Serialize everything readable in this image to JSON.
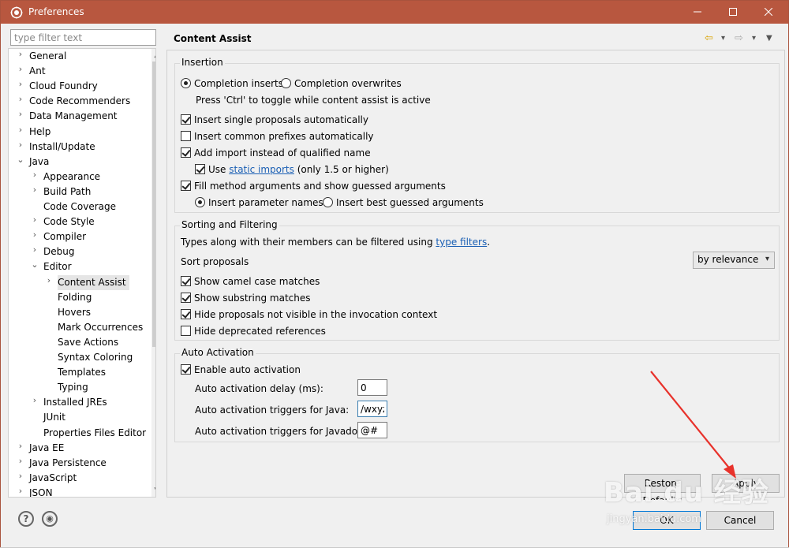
{
  "window": {
    "title": "Preferences",
    "minimize": "—",
    "maximize": "☐",
    "close": "✕"
  },
  "filter": {
    "placeholder": "type filter text",
    "value": ""
  },
  "tree": [
    {
      "label": "General",
      "chev": "›"
    },
    {
      "label": "Ant",
      "chev": "›"
    },
    {
      "label": "Cloud Foundry",
      "chev": "›"
    },
    {
      "label": "Code Recommenders",
      "chev": "›"
    },
    {
      "label": "Data Management",
      "chev": "›"
    },
    {
      "label": "Help",
      "chev": "›"
    },
    {
      "label": "Install/Update",
      "chev": "›"
    },
    {
      "label": "Java",
      "chev": "⌄"
    },
    {
      "label": "Appearance",
      "chev": "›"
    },
    {
      "label": "Build Path",
      "chev": "›"
    },
    {
      "label": "Code Coverage",
      "chev": ""
    },
    {
      "label": "Code Style",
      "chev": "›"
    },
    {
      "label": "Compiler",
      "chev": "›"
    },
    {
      "label": "Debug",
      "chev": "›"
    },
    {
      "label": "Editor",
      "chev": "⌄"
    },
    {
      "label": "Content Assist",
      "chev": "›"
    },
    {
      "label": "Folding",
      "chev": ""
    },
    {
      "label": "Hovers",
      "chev": ""
    },
    {
      "label": "Mark Occurrences",
      "chev": ""
    },
    {
      "label": "Save Actions",
      "chev": ""
    },
    {
      "label": "Syntax Coloring",
      "chev": ""
    },
    {
      "label": "Templates",
      "chev": ""
    },
    {
      "label": "Typing",
      "chev": ""
    },
    {
      "label": "Installed JREs",
      "chev": "›"
    },
    {
      "label": "JUnit",
      "chev": ""
    },
    {
      "label": "Properties Files Editor",
      "chev": ""
    },
    {
      "label": "Java EE",
      "chev": "›"
    },
    {
      "label": "Java Persistence",
      "chev": "›"
    },
    {
      "label": "JavaScript",
      "chev": "›"
    },
    {
      "label": "JSON",
      "chev": "›"
    }
  ],
  "page": {
    "title": "Content Assist",
    "nav_back": "⇦",
    "nav_forward": "⇨",
    "dropdown": "▾",
    "menu": "▼"
  },
  "insertion": {
    "label": "Insertion",
    "completion_inserts": "Completion inserts",
    "completion_overwrites": "Completion overwrites",
    "toggle_hint": "Press 'Ctrl' to toggle while content assist is active",
    "single_proposals": "Insert single proposals automatically",
    "common_prefixes": "Insert common prefixes automatically",
    "add_import": "Add import instead of qualified name",
    "use_label": "Use",
    "static_imports_link": "static imports",
    "static_imports_suffix": "(only 1.5 or higher)",
    "fill_method_args": "Fill method arguments and show guessed arguments",
    "insert_param_names": "Insert parameter names",
    "insert_best_guessed": "Insert best guessed arguments"
  },
  "sorting": {
    "label": "Sorting and Filtering",
    "types_text": "Types along with their members can be filtered using",
    "type_filters_link": "type filters",
    "period": ".",
    "sort_proposals": "Sort proposals",
    "sort_value": "by relevance",
    "camel_case": "Show camel case matches",
    "substring": "Show substring matches",
    "hide_not_visible": "Hide proposals not visible in the invocation context",
    "hide_deprecated": "Hide deprecated references"
  },
  "auto": {
    "label": "Auto Activation",
    "enable": "Enable auto activation",
    "delay_label": "Auto activation delay (ms):",
    "delay_value": "0",
    "java_label": "Auto activation triggers for Java:",
    "java_value": "/wxyz",
    "javadoc_label": "Auto activation triggers for Javadoc:",
    "javadoc_value": "@#"
  },
  "buttons": {
    "restore_defaults": "Restore Defaults",
    "apply": "Apply",
    "ok": "OK",
    "cancel": "Cancel"
  },
  "footer_icons": {
    "help": "?",
    "record": "◉"
  },
  "watermark": {
    "main": "Bai du 经验",
    "sub": "jingyan.baidu.com"
  },
  "colors": {
    "titlebar": "#b8573f",
    "link": "#1a5fb4",
    "arrow": "#e8322b"
  }
}
